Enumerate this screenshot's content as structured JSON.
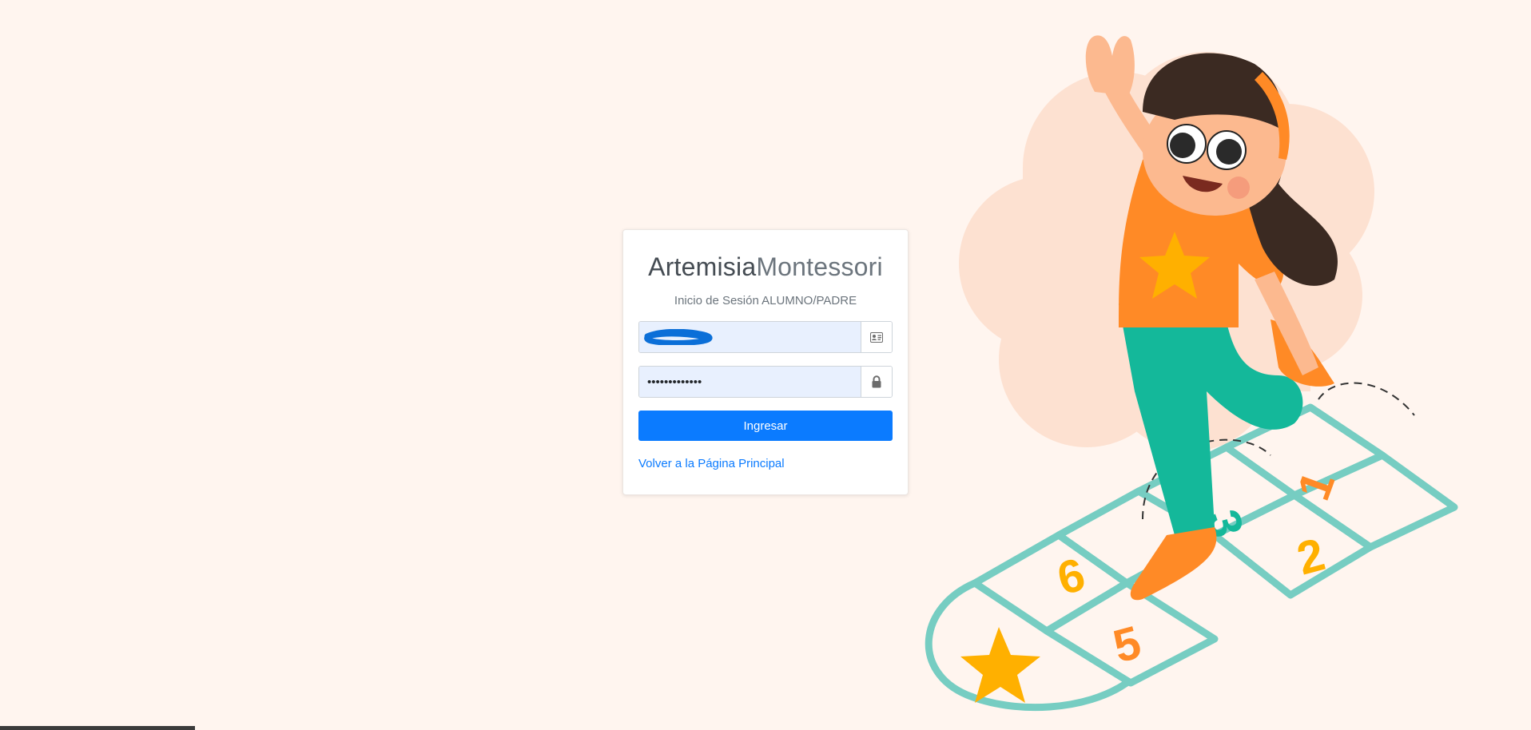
{
  "brand": {
    "part1": "Artemisia",
    "part2": "Montessori"
  },
  "login": {
    "subtitle": "Inicio de Sesión ALUMNO/PADRE",
    "username_value": "",
    "password_value": "•••••••••••••",
    "submit_label": "Ingresar",
    "back_link_label": "Volver a la Página Principal"
  },
  "icons": {
    "username": "id-card-icon",
    "password": "lock-icon"
  },
  "illustration": {
    "hopscotch_numbers": [
      "1",
      "2",
      "3",
      "5",
      "6"
    ]
  },
  "colors": {
    "background": "#fff5ef",
    "primary": "#0b7bff",
    "autofill": "#e8f0fe",
    "cloud": "#fde1d1",
    "hopscotch": "#76cdc2",
    "orange": "#ff8a26",
    "teal": "#14b89a",
    "yellow": "#ffb000"
  }
}
